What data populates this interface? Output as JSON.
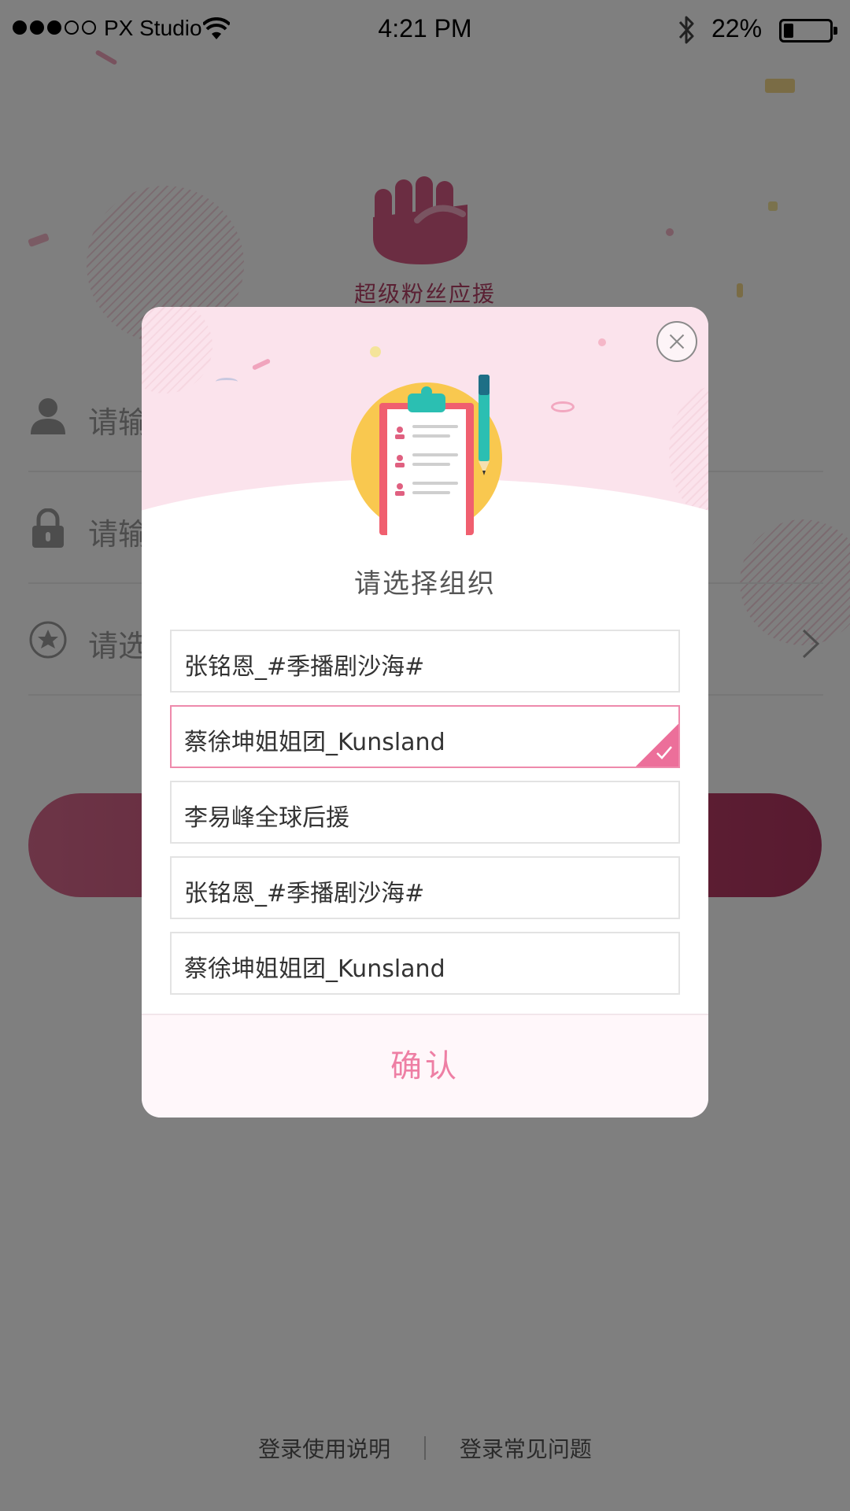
{
  "status_bar": {
    "carrier": "PX Studio",
    "time": "4:21 PM",
    "battery_percent": "22%",
    "battery_level": 0.22,
    "signal_bars_filled": 3,
    "signal_bars_total": 5
  },
  "login_page": {
    "app_name": "超级粉丝应援",
    "username_placeholder": "请输",
    "password_placeholder": "请输",
    "organization_placeholder": "请选",
    "footer": {
      "instructions_link": "登录使用说明",
      "faq_link": "登录常见问题"
    },
    "icons": [
      "fist-logo-icon",
      "user-icon",
      "lock-icon",
      "star-icon",
      "chevron-right-icon"
    ]
  },
  "modal": {
    "title": "请选择组织",
    "organizations": [
      {
        "label": "张铭恩_#季播剧沙海#",
        "selected": false
      },
      {
        "label": "蔡徐坤姐姐团_Kunsland",
        "selected": true
      },
      {
        "label": "李易峰全球后援",
        "selected": false
      },
      {
        "label": "张铭恩_#季播剧沙海#",
        "selected": false
      },
      {
        "label": "蔡徐坤姐姐团_Kunsland",
        "selected": false
      }
    ],
    "confirm_label": "确认",
    "icons": [
      "close-icon",
      "clipboard-illustration",
      "pen-icon",
      "check-icon"
    ]
  },
  "colors": {
    "accent_pink": "#ec6f9a",
    "brand_red": "#c4456f",
    "header_pink": "#fbe3ec"
  }
}
